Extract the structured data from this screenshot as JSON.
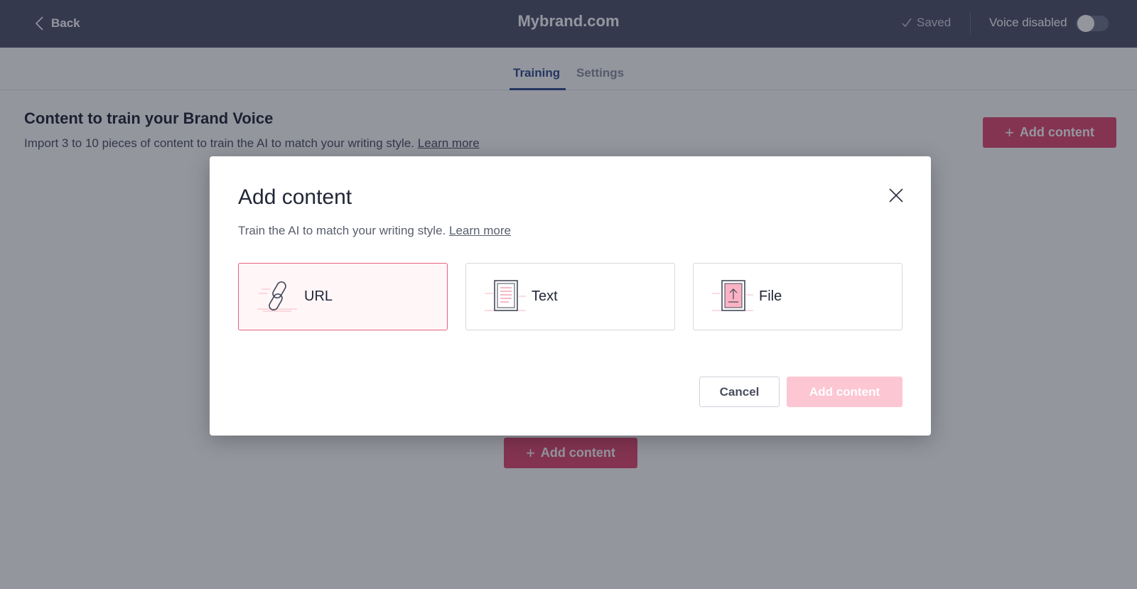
{
  "header": {
    "back_label": "Back",
    "brand": "Mybrand.com",
    "saved_label": "Saved",
    "voice_label": "Voice disabled",
    "voice_enabled": false
  },
  "tabs": [
    {
      "label": "Training",
      "active": true
    },
    {
      "label": "Settings",
      "active": false
    }
  ],
  "main": {
    "title": "Content to train your Brand Voice",
    "description": "Import 3 to 10 pieces of content to train the AI to match your writing style.",
    "learn_more": "Learn more",
    "add_content_label": "Add content"
  },
  "modal": {
    "title": "Add content",
    "description": "Train the AI to match your writing style.",
    "learn_more": "Learn more",
    "options": [
      {
        "label": "URL",
        "icon": "link-icon",
        "selected": true
      },
      {
        "label": "Text",
        "icon": "document-icon",
        "selected": false
      },
      {
        "label": "File",
        "icon": "file-upload-icon",
        "selected": false
      }
    ],
    "cancel_label": "Cancel",
    "submit_label": "Add content"
  },
  "colors": {
    "header_bg": "#4c5068",
    "accent": "#e0476e",
    "accent_disabled": "#fcc6d3",
    "tab_active": "#2d4a8a",
    "selected_border": "#e8607f"
  }
}
